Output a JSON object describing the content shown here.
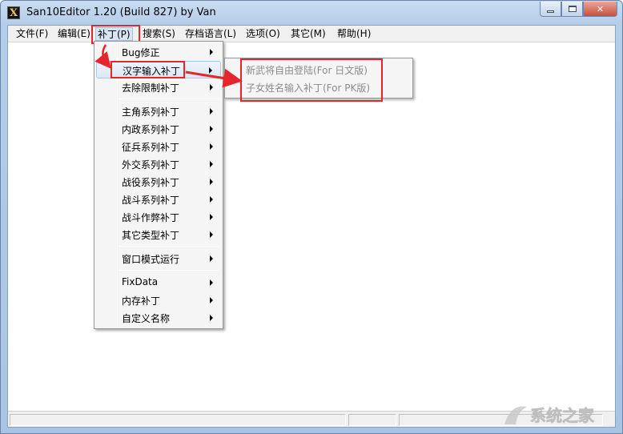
{
  "window": {
    "title": "San10Editor 1.20 (Build 827) by Van",
    "app_icon_glyph": "X"
  },
  "menubar": {
    "items": [
      {
        "label": "文件(F)"
      },
      {
        "label": "编辑(E)"
      },
      {
        "label": "补丁(P)"
      },
      {
        "label": "搜索(S)"
      },
      {
        "label": "存档语言(L)"
      },
      {
        "label": "选项(O)"
      },
      {
        "label": "其它(M)"
      },
      {
        "label": "帮助(H)"
      }
    ],
    "active_index": 2
  },
  "patch_menu": {
    "items": [
      {
        "label": "Bug修正"
      },
      {
        "label": "汉字输入补丁"
      },
      {
        "label": "去除限制补丁"
      },
      {
        "label": "主角系列补丁"
      },
      {
        "label": "内政系列补丁"
      },
      {
        "label": "征兵系列补丁"
      },
      {
        "label": "外交系列补丁"
      },
      {
        "label": "战役系列补丁"
      },
      {
        "label": "战斗系列补丁"
      },
      {
        "label": "战斗作弊补丁"
      },
      {
        "label": "其它类型补丁"
      },
      {
        "label": "窗口模式运行"
      },
      {
        "label": "FixData"
      },
      {
        "label": "内存补丁"
      },
      {
        "label": "自定义名称"
      }
    ],
    "hovered_index": 1
  },
  "submenu": {
    "items": [
      {
        "label": "新武将自由登陆(For 日文版)",
        "enabled": false
      },
      {
        "label": "子女姓名输入补丁(For PK版)",
        "enabled": false
      }
    ]
  },
  "colors": {
    "highlight_box": "#e5262d",
    "menu_bg": "#f5f5f5",
    "disabled_text": "#8c8c8c"
  },
  "watermark": {
    "text": "系统之家"
  }
}
